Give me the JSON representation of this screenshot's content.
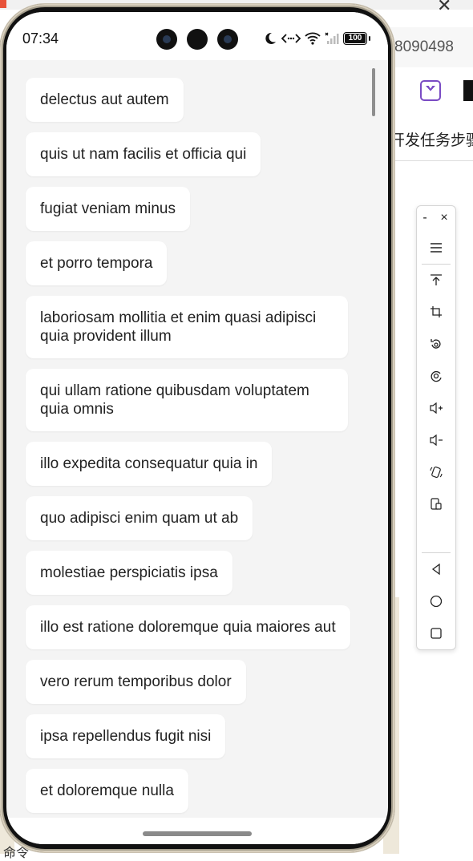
{
  "background": {
    "url_fragment": "8090498",
    "text_fragment": "开发任务步骤",
    "close_glyph": "✕",
    "bottom_text": "命令"
  },
  "status_bar": {
    "time": "07:34",
    "battery": "100"
  },
  "list": {
    "items": [
      "delectus aut autem",
      "quis ut nam facilis et officia qui",
      "fugiat veniam minus",
      "et porro tempora",
      "laboriosam mollitia et enim quasi adipisci quia provident illum",
      "qui ullam ratione quibusdam voluptatem quia omnis",
      "illo expedita consequatur quia in",
      "quo adipisci enim quam ut ab",
      "molestiae perspiciatis ipsa",
      "illo est ratione doloremque quia maiores aut",
      "vero rerum temporibus dolor",
      "ipsa repellendus fugit nisi",
      "et doloremque nulla"
    ]
  },
  "toolbar": {
    "minimize_glyph": "-",
    "close_glyph": "×",
    "menu_icon": "menu-icon",
    "tools": [
      "pin-top-icon",
      "crop-icon",
      "rotate-icon",
      "screenshot-icon",
      "volume-up-icon",
      "volume-down-icon",
      "shake-icon",
      "switch-screen-icon"
    ],
    "nav": [
      "back-icon",
      "home-icon",
      "recents-icon"
    ]
  }
}
